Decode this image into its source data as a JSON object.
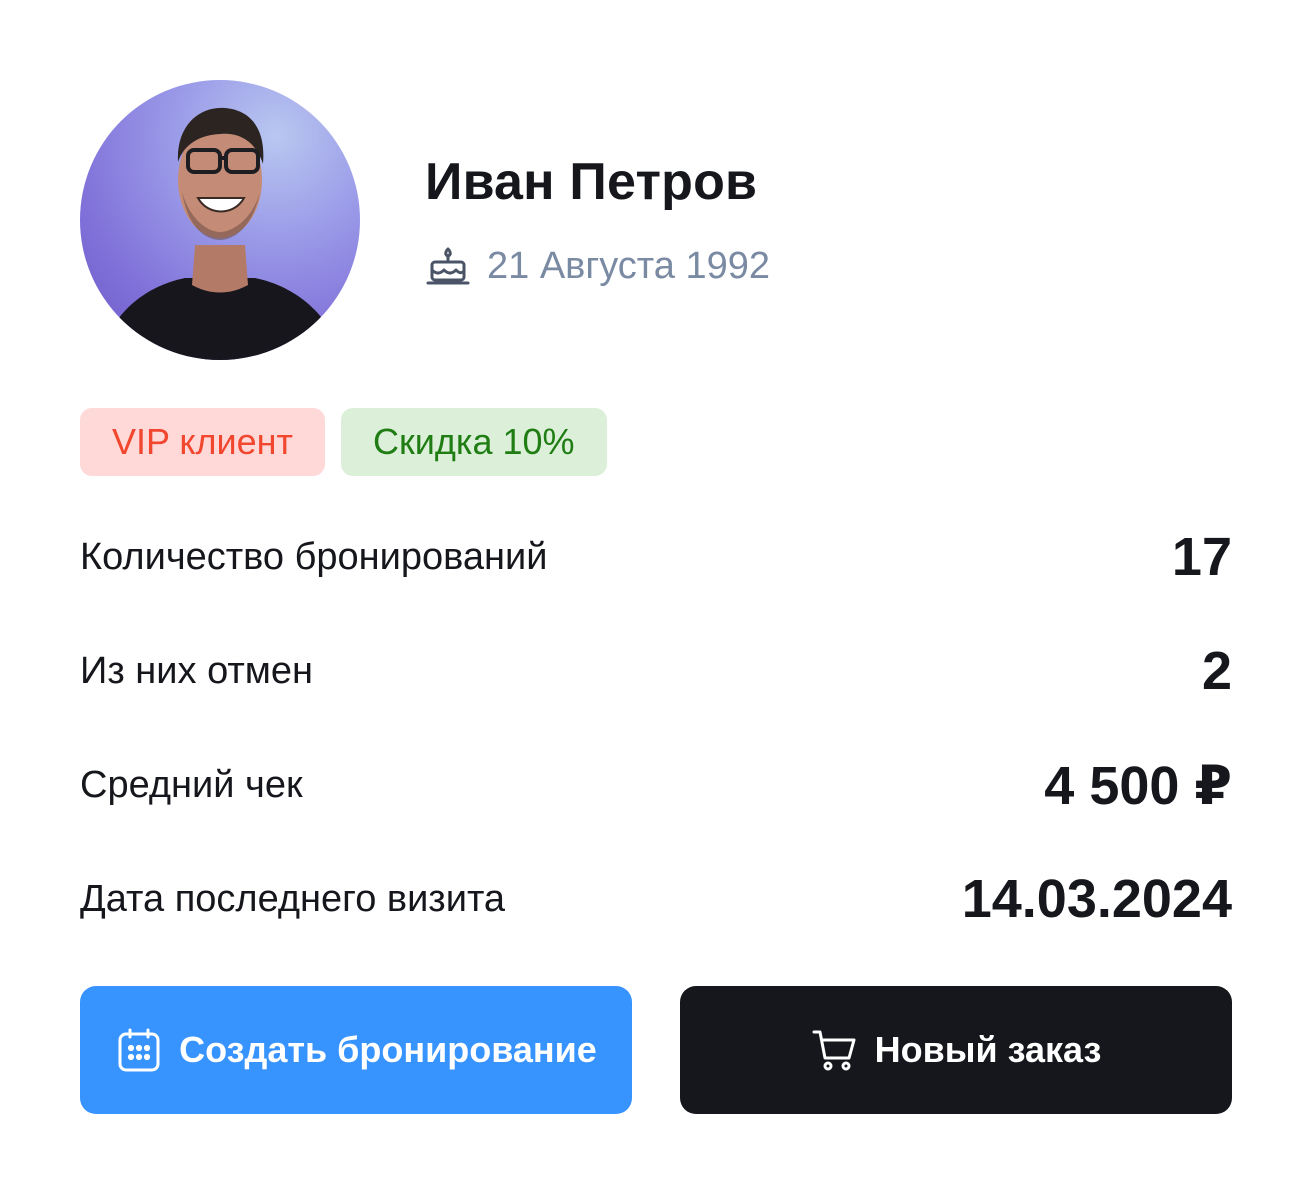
{
  "profile": {
    "name": "Иван Петров",
    "birth_date": "21 Августа 1992",
    "avatar_alt": "Иван Петров"
  },
  "tags": [
    {
      "label": "VIP клиент",
      "kind": "vip",
      "text_color": "#f2472f",
      "bg_color": "#ffd8d8"
    },
    {
      "label": "Скидка 10%",
      "kind": "discount",
      "text_color": "#207d14",
      "bg_color": "#dcefd9"
    }
  ],
  "stats": [
    {
      "label": "Количество бронирований",
      "value": "17"
    },
    {
      "label": "Из них отмен",
      "value": "2"
    },
    {
      "label": "Средний чек",
      "value": "4 500 ₽"
    },
    {
      "label": "Дата последнего визита",
      "value": "14.03.2024"
    }
  ],
  "actions": {
    "create_booking": {
      "label": "Создать бронирование",
      "icon": "calendar-icon",
      "color": "#3794ff"
    },
    "new_order": {
      "label": "Новый заказ",
      "icon": "cart-icon",
      "color": "#15171c"
    }
  },
  "icons": {
    "birthday": "cake-icon"
  }
}
